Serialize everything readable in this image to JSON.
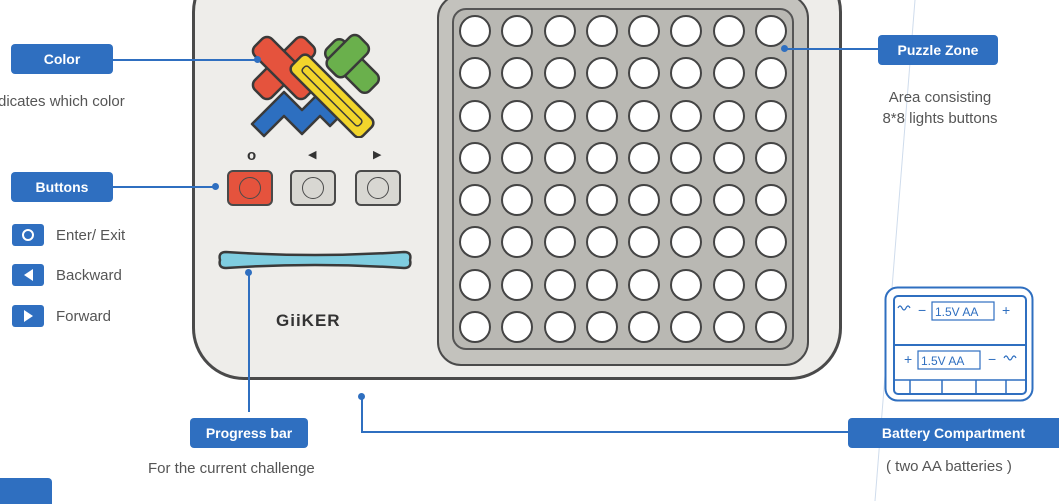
{
  "color": {
    "tag": "Color",
    "desc": "dicates which color"
  },
  "buttons": {
    "tag": "Buttons",
    "items": [
      {
        "label": "Enter/ Exit",
        "icon": "circle-icon"
      },
      {
        "label": "Backward",
        "icon": "triangle-left-icon"
      },
      {
        "label": "Forward",
        "icon": "triangle-right-icon"
      }
    ],
    "glyphs": [
      "o",
      "◀",
      "▶"
    ]
  },
  "puzzle_zone": {
    "tag": "Puzzle Zone",
    "desc_line1": "Area consisting",
    "desc_line2": "8*8 lights buttons"
  },
  "progress_bar": {
    "tag": "Progress bar",
    "desc": "For the current challenge"
  },
  "battery": {
    "tag": "Battery Compartment",
    "desc": "( two AA batteries )",
    "cell_label": "1.5V AA"
  },
  "brand": "GiiKER",
  "colors": {
    "accent": "#2f6fc0",
    "red": "#e5533d",
    "green": "#6ab04c",
    "yellow": "#f2d52b",
    "blue": "#2d6fc0",
    "progress": "#7fcde0"
  }
}
